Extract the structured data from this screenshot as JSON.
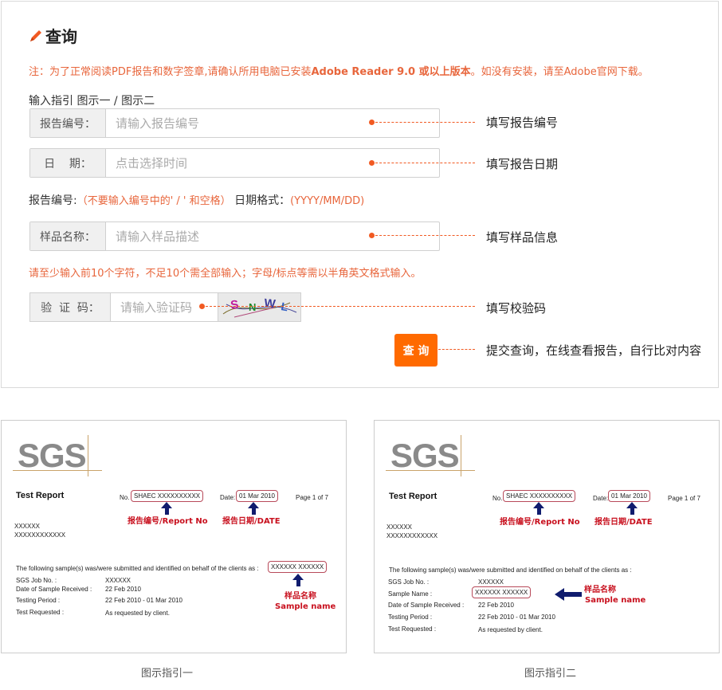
{
  "header": {
    "title": "查询"
  },
  "notice": {
    "prefix": "注：为了正常阅读PDF报告和数字签章,请确认所用电脑已安装",
    "bold": "Adobe Reader 9.0 或以上版本",
    "suffix": "。如没有安装，请至Adobe官网下载。"
  },
  "guide": {
    "label": "输入指引",
    "link1": "图示一",
    "sep": " / ",
    "link2": "图示二"
  },
  "form": {
    "report_no": {
      "label": "报告编号：",
      "placeholder": "请输入报告编号",
      "hint": "填写报告编号"
    },
    "date": {
      "label": "日    期：",
      "placeholder": "点击选择时间",
      "hint": "填写报告日期"
    },
    "format": {
      "report_label": "报告编号:",
      "report_rule": "（不要输入编号中的' / ' 和空格）",
      "date_label": "日期格式：",
      "date_rule": "(YYYY/MM/DD)"
    },
    "sample": {
      "label": "样品名称：",
      "placeholder": "请输入样品描述",
      "hint": "填写样品信息"
    },
    "sample_note": "请至少输入前10个字符，不足10个需全部输入；字母/标点等需以半角英文格式输入。",
    "captcha": {
      "label": "验  证  码：",
      "placeholder": "请输入验证码",
      "code": "SNWL",
      "hint": "填写校验码"
    },
    "submit": {
      "label": "查 询",
      "hint": "提交查询，在线查看报告，自行比对内容"
    }
  },
  "examples": [
    {
      "caption": "图示指引一",
      "logo": "SGS",
      "test_report": "Test Report",
      "no_label": "No.",
      "no_value": "SHAEC XXXXXXXXXX",
      "date_label": "Date:",
      "date_value": "01 Mar 2010",
      "page": "Page 1 of 7",
      "ann_report": "报告编号/Report No",
      "ann_date": "报告日期/DATE",
      "client1": "XXXXXX",
      "client2": "XXXXXXXXXXXX",
      "statement": "The following sample(s) was/were submitted and identified on behalf of the clients as :",
      "sample_box": "XXXXXX  XXXXXX",
      "rows": [
        {
          "k": "SGS Job No. :",
          "v": "XXXXXX"
        },
        {
          "k": "Date of Sample Received :",
          "v": "22 Feb 2010"
        },
        {
          "k": "Testing Period :",
          "v": "22 Feb 2010 - 01 Mar 2010"
        },
        {
          "k": "Test Requested :",
          "v": "As requested by client."
        }
      ],
      "ann_sample_cn": "样品名称",
      "ann_sample_en": "Sample name"
    },
    {
      "caption": "图示指引二",
      "logo": "SGS",
      "test_report": "Test Report",
      "no_label": "No.",
      "no_value": "SHAEC XXXXXXXXXX",
      "date_label": "Date:",
      "date_value": "01 Mar 2010",
      "page": "Page 1 of 7",
      "ann_report": "报告编号/Report No",
      "ann_date": "报告日期/DATE",
      "client1": "XXXXXX",
      "client2": "XXXXXXXXXXXX",
      "statement": "The following sample(s) was/were submitted and identified on behalf of the clients as :",
      "sample_box": "XXXXXX   XXXXXX",
      "rows": [
        {
          "k": "SGS Job No. :",
          "v": "XXXXXX"
        },
        {
          "k": "Sample Name :",
          "v": ""
        },
        {
          "k": "Date of Sample Received :",
          "v": "22 Feb 2010"
        },
        {
          "k": "Testing Period :",
          "v": "22 Feb 2010 - 01 Mar 2010"
        },
        {
          "k": "Test Requested :",
          "v": "As requested by client."
        }
      ],
      "ann_sample_cn": "样品名称",
      "ann_sample_en": "Sample name"
    }
  ],
  "colors": {
    "accent": "#ff6a00",
    "notice": "#e8663c",
    "annotation_red": "#c8101e",
    "arrow_navy": "#101c6e"
  }
}
